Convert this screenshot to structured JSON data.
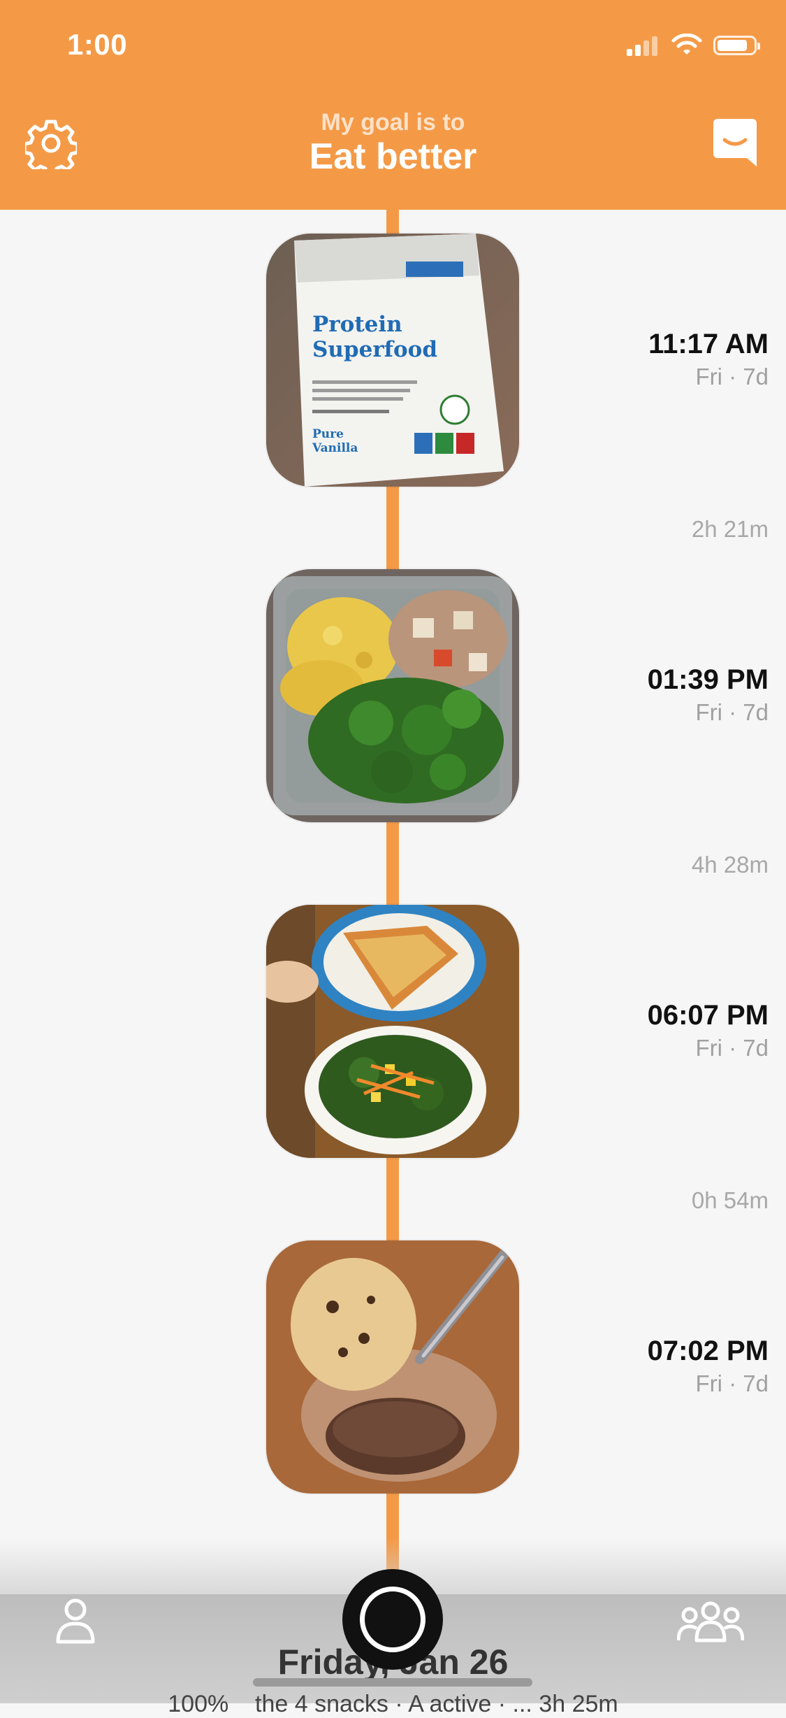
{
  "status_bar": {
    "time": "1:00",
    "icons": [
      "signal-icon",
      "wifi-icon",
      "battery-icon"
    ]
  },
  "header": {
    "caption": "My goal is to",
    "title": "Eat better",
    "left_icon": "gear-icon",
    "right_icon": "chat-icon",
    "background_color": "#f49a47"
  },
  "timeline": {
    "entries": [
      {
        "time": "11:17 AM",
        "day": "Fri · 7d",
        "photo": "protein-superfood-packet-photo"
      },
      {
        "time": "01:39 PM",
        "day": "Fri · 7d",
        "photo": "eggs-broccoli-dish-photo"
      },
      {
        "time": "06:07 PM",
        "day": "Fri · 7d",
        "photo": "pizza-salad-photo"
      },
      {
        "time": "07:02 PM",
        "day": "Fri · 7d",
        "photo": "cookie-ice-cream-photo"
      }
    ],
    "gaps": [
      "2h 21m",
      "4h 28m",
      "0h 54m"
    ],
    "packet_text": {
      "title_line1": "Protein",
      "title_line2": "Superfood",
      "flavor_line1": "Pure",
      "flavor_line2": "Vanilla"
    }
  },
  "bottom_bar": {
    "left_icon": "profile-icon",
    "center_icon": "camera-shutter-icon",
    "right_icon": "community-icon",
    "date": "Friday, Jan 26",
    "summary": "100%    the 4 snacks · A active · ... 3h 25m"
  }
}
